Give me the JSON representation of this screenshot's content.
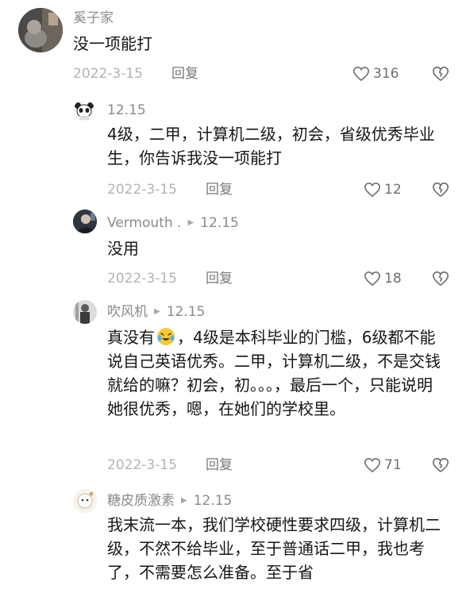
{
  "comments": [
    {
      "user": "奚子家",
      "text": "没一项能打",
      "date": "2022-3-15",
      "reply_label": "回复",
      "likes": "316"
    },
    {
      "user": "12.15",
      "text": "4级，二甲，计算机二级，初会，省级优秀毕业生，你告诉我没一项能打",
      "date": "2022-3-15",
      "reply_label": "回复",
      "likes": "12"
    },
    {
      "user": "Vermouth .",
      "reply_to": "12.15",
      "text": "没用",
      "date": "2022-3-15",
      "reply_label": "回复",
      "likes": "18"
    },
    {
      "user": "吹风机",
      "reply_to": "12.15",
      "text_before_emoji": "真没有",
      "text_after_emoji": "，4级是本科毕业的门槛，6级都不能说自己英语优秀。二甲，计算机二级，不是交钱就给的嘛？初会，初。。。，最后一个，只能说明她很优秀，嗯，在她们的学校里。",
      "emoji": "crying-laughing-emoji",
      "date": "2022-3-15",
      "reply_label": "回复",
      "likes": "71"
    },
    {
      "user": "糖皮质激素",
      "reply_to": "12.15",
      "text": "我末流一本，我们学校硬性要求四级，计算机二级，不然不给毕业，至于普通话二甲，我也考了，不需要怎么准备。至于省"
    }
  ],
  "colors": {
    "username": "#8a8a8a",
    "date": "#b3b3b3",
    "reply": "#7a7a7a",
    "text": "#161616"
  }
}
